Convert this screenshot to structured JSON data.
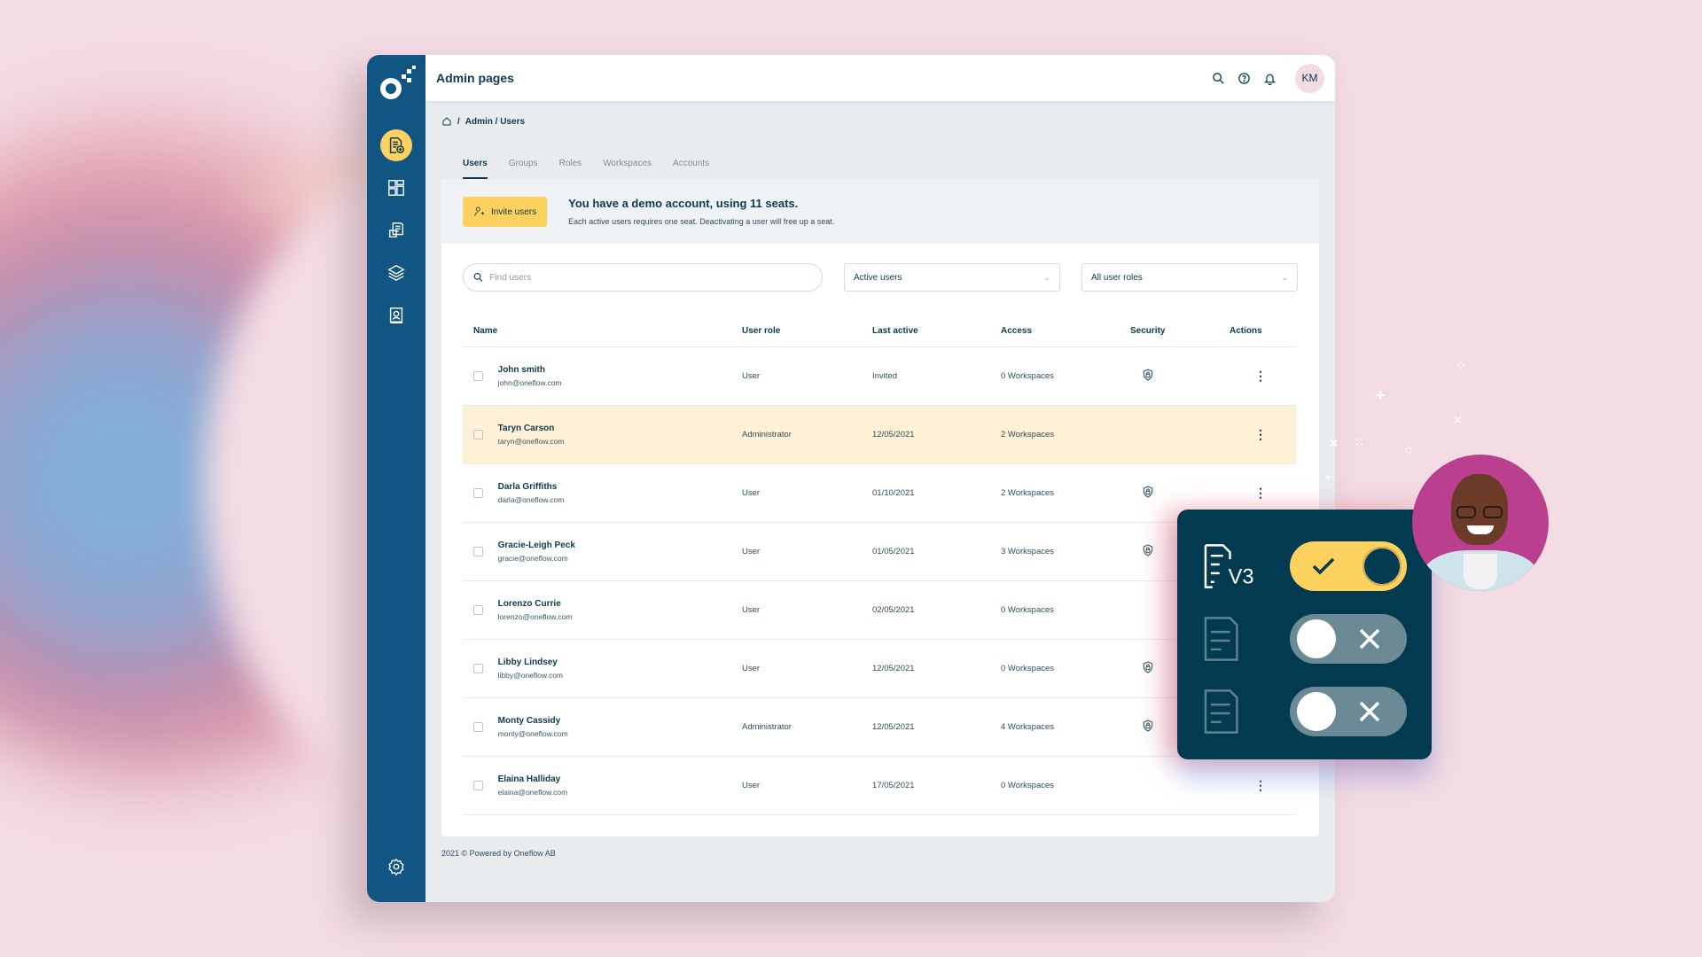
{
  "colors": {
    "sidebar": "#115583",
    "accent_yellow": "#fdd15e",
    "highlight_row": "#fff1d6",
    "text_dark": "#0d3a4f",
    "toggle_card": "#023a50",
    "avatar_bg": "#bb3f8f"
  },
  "sidebar": {
    "logo": "oneflow-logo",
    "items": [
      {
        "icon": "document-add-icon",
        "active": true
      },
      {
        "icon": "dashboard-icon",
        "active": false
      },
      {
        "icon": "documents-icon",
        "active": false
      },
      {
        "icon": "layers-icon",
        "active": false
      },
      {
        "icon": "address-book-icon",
        "active": false
      }
    ],
    "settings_icon": "gear-icon"
  },
  "header": {
    "title": "Admin pages",
    "icons": [
      "search-icon",
      "help-icon",
      "bell-icon"
    ],
    "user_initials": "KM"
  },
  "breadcrumb": {
    "home_icon": "home-icon",
    "separator": "/",
    "path": "Admin / Users"
  },
  "tabs": [
    {
      "label": "Users",
      "active": true
    },
    {
      "label": "Groups",
      "active": false
    },
    {
      "label": "Roles",
      "active": false
    },
    {
      "label": "Workspaces",
      "active": false
    },
    {
      "label": "Accounts",
      "active": false
    }
  ],
  "banner": {
    "invite_label": "Invite users",
    "heading": "You have a demo account, using 11 seats.",
    "subtext": "Each active users requires one seat. Deactivating a user will free up a seat."
  },
  "filters": {
    "search_placeholder": "Find users",
    "search_value": "",
    "status_selected": "Active users",
    "role_selected": "All user roles"
  },
  "table": {
    "columns": [
      "Name",
      "User role",
      "Last active",
      "Access",
      "Security",
      "Actions"
    ],
    "rows": [
      {
        "name": "John smith",
        "email": "john@oneflow.com",
        "role": "User",
        "last_active": "Invited",
        "access": "0 Workspaces",
        "security": true,
        "highlighted": false
      },
      {
        "name": "Taryn Carson",
        "email": "taryn@oneflow.com",
        "role": "Administrator",
        "last_active": "12/05/2021",
        "access": "2 Workspaces",
        "security": false,
        "highlighted": true
      },
      {
        "name": "Darla Griffiths",
        "email": "darla@oneflow.com",
        "role": "User",
        "last_active": "01/10/2021",
        "access": "2 Workspaces",
        "security": true,
        "highlighted": false
      },
      {
        "name": "Gracie-Leigh Peck",
        "email": "gracie@oneflow.com",
        "role": "User",
        "last_active": "01/05/2021",
        "access": "3 Workspaces",
        "security": true,
        "highlighted": false
      },
      {
        "name": "Lorenzo Currie",
        "email": "lorenzo@oneflow.com",
        "role": "User",
        "last_active": "02/05/2021",
        "access": "0 Workspaces",
        "security": false,
        "highlighted": false
      },
      {
        "name": "Libby Lindsey",
        "email": "libby@oneflow.com",
        "role": "User",
        "last_active": "12/05/2021",
        "access": "0 Workspaces",
        "security": true,
        "highlighted": false
      },
      {
        "name": "Monty Cassidy",
        "email": "monty@oneflow.com",
        "role": "Administrator",
        "last_active": "12/05/2021",
        "access": "4 Workspaces",
        "security": true,
        "highlighted": false
      },
      {
        "name": "Elaina Halliday",
        "email": "elaina@oneflow.com",
        "role": "User",
        "last_active": "17/05/2021",
        "access": "0 Workspaces",
        "security": false,
        "highlighted": false
      }
    ],
    "actions_icon": "more-vertical-icon"
  },
  "footer": {
    "text": "2021 © Powered by Oneflow AB"
  },
  "overlay": {
    "versions": [
      {
        "label": "V3",
        "enabled": true
      },
      {
        "label": "",
        "enabled": false
      },
      {
        "label": "",
        "enabled": false
      }
    ]
  }
}
